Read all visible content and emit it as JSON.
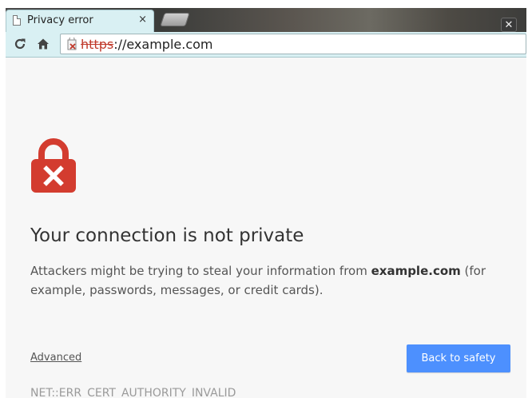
{
  "tab": {
    "title": "Privacy error",
    "close_glyph": "×",
    "icon": "page-icon"
  },
  "window": {
    "close_glyph": "✕"
  },
  "toolbar": {
    "reload_icon": "reload-icon",
    "home_icon": "home-icon"
  },
  "omnibox": {
    "scheme": "https",
    "rest": "://example.com",
    "security_icon": "broken-lock-icon"
  },
  "page": {
    "heading": "Your connection is not private",
    "message_before": "Attackers might be trying to steal your information from ",
    "message_domain": "example.com",
    "message_after": " (for example, passwords, messages, or credit cards).",
    "advanced_label": "Advanced",
    "back_button_label": "Back to safety",
    "error_code": "NET::ERR_CERT_AUTHORITY_INVALID"
  },
  "colors": {
    "toolbar_bg": "#d9f0f3",
    "lock_red": "#d33c2f",
    "button_blue": "#4d90fe",
    "page_bg": "#f7f7f7"
  }
}
